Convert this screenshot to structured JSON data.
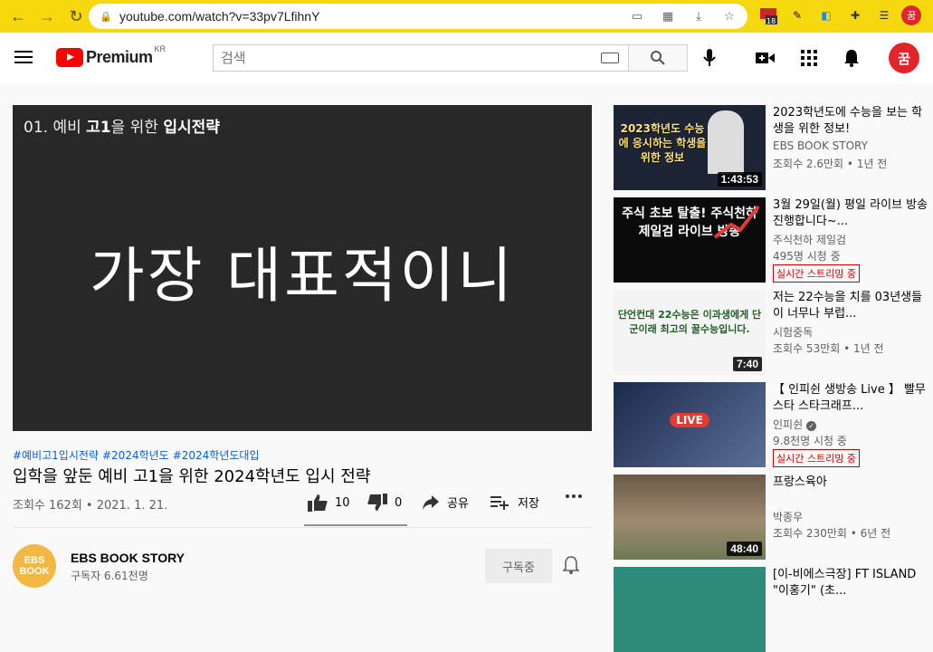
{
  "browser": {
    "url": "youtube.com/watch?v=33pv7LfihnY",
    "extension_badge": "18"
  },
  "header": {
    "logo_text": "Premium",
    "logo_region": "KR",
    "search_placeholder": "검색",
    "avatar_text": "꿈"
  },
  "player": {
    "episode_prefix": "01. 예비 ",
    "episode_bold1": "고1",
    "episode_mid": "을 위한 ",
    "episode_bold2": "입시전략",
    "subtitle": "가장 대표적이니"
  },
  "video": {
    "tags": [
      "#예비고1입시전략",
      "#2024학년도",
      "#2024학년도대입"
    ],
    "title": "입학을 앞둔 예비 고1을 위한 2024학년도 입시 전략",
    "meta": "조회수 162회 • 2021. 1. 21.",
    "likes": "10",
    "dislikes": "0",
    "share_label": "공유",
    "save_label": "저장",
    "like_ratio": 1.0
  },
  "channel": {
    "avatar_text": "EBS BOOK",
    "name": "EBS BOOK STORY",
    "subscribers": "구독자 6.61천명",
    "subscribe_label": "구독중"
  },
  "recommendations": [
    {
      "title": "2023학년도에 수능을 보는 학생을 위한 정보!",
      "channel": "EBS BOOK STORY",
      "meta": "조회수 2.6만회 • 1년 전",
      "duration": "1:43:53",
      "thumb_text": "2023학년도 수능에 응시하는 학생을 위한 정보",
      "live": ""
    },
    {
      "title": "3월 29일(월) 평일 라이브 방송 진행합니다~...",
      "channel": "주식천하 제일검",
      "meta": "495명 시청 중",
      "duration": "",
      "thumb_text": "주식 초보 탈출! 주식천하 제일검 라이브 방송",
      "live": "실시간 스트리밍 중"
    },
    {
      "title": "저는 22수능을 치를 03년생들이 너무나 부럽...",
      "channel": "시험중독",
      "meta": "조회수 53만회 • 1년 전",
      "duration": "7:40",
      "thumb_text": "단언컨대 22수능은 이과생에게 단군이래 최고의 꿀수능입니다.",
      "live": ""
    },
    {
      "title": "【 인피쉰 생방송 Live 】 빨무 스타 스타크래프...",
      "channel": "인피쉰",
      "meta": "9.8천명 시청 중",
      "duration": "",
      "thumb_text": "LIVE",
      "live": "실시간 스트리밍 중"
    },
    {
      "title": "프랑스육아",
      "channel": "박종우",
      "meta": "조회수 230만회 • 6년 전",
      "duration": "48:40",
      "thumb_text": "",
      "live": ""
    },
    {
      "title": "[이-비에스극장] FT ISLAND \"이홍기\" (초...",
      "channel": "",
      "meta": "",
      "duration": "",
      "thumb_text": "",
      "live": ""
    }
  ]
}
